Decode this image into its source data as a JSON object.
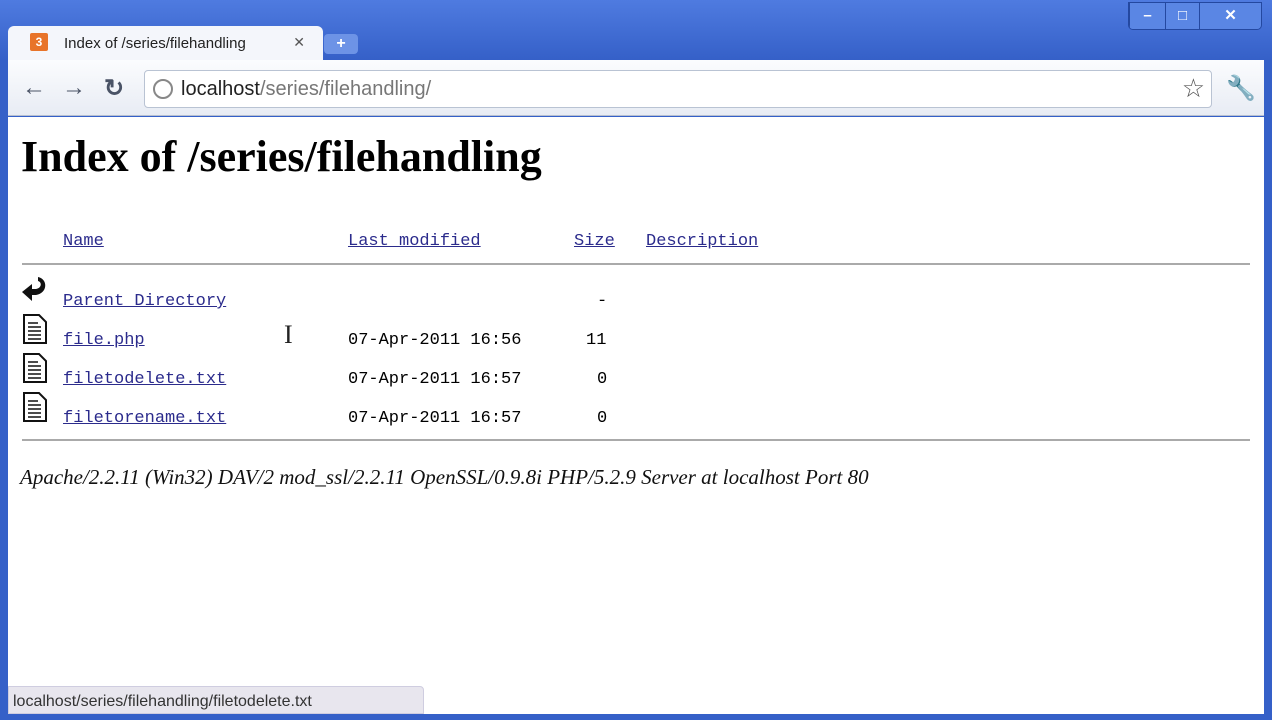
{
  "browser": {
    "tab_title": "Index of /series/filehandling",
    "address_host": "localhost",
    "address_path": "/series/filehandling/",
    "status_url": "localhost/series/filehandling/filetodelete.txt"
  },
  "page": {
    "title": "Index of /series/filehandling",
    "columns": [
      "Name",
      "Last modified",
      "Size",
      "Description"
    ],
    "rows": [
      {
        "name": "Parent Directory",
        "modified": "",
        "size": "-",
        "icon": "back-arrow-icon"
      },
      {
        "name": "file.php",
        "modified": "07-Apr-2011 16:56",
        "size": "11",
        "icon": "file-icon"
      },
      {
        "name": "filetodelete.txt",
        "modified": "07-Apr-2011 16:57",
        "size": "0",
        "icon": "file-icon"
      },
      {
        "name": "filetorename.txt",
        "modified": "07-Apr-2011 16:57",
        "size": "0",
        "icon": "file-icon"
      }
    ],
    "footer": "Apache/2.2.11 (Win32) DAV/2 mod_ssl/2.2.11 OpenSSL/0.9.8i PHP/5.2.9 Server at localhost Port 80"
  }
}
